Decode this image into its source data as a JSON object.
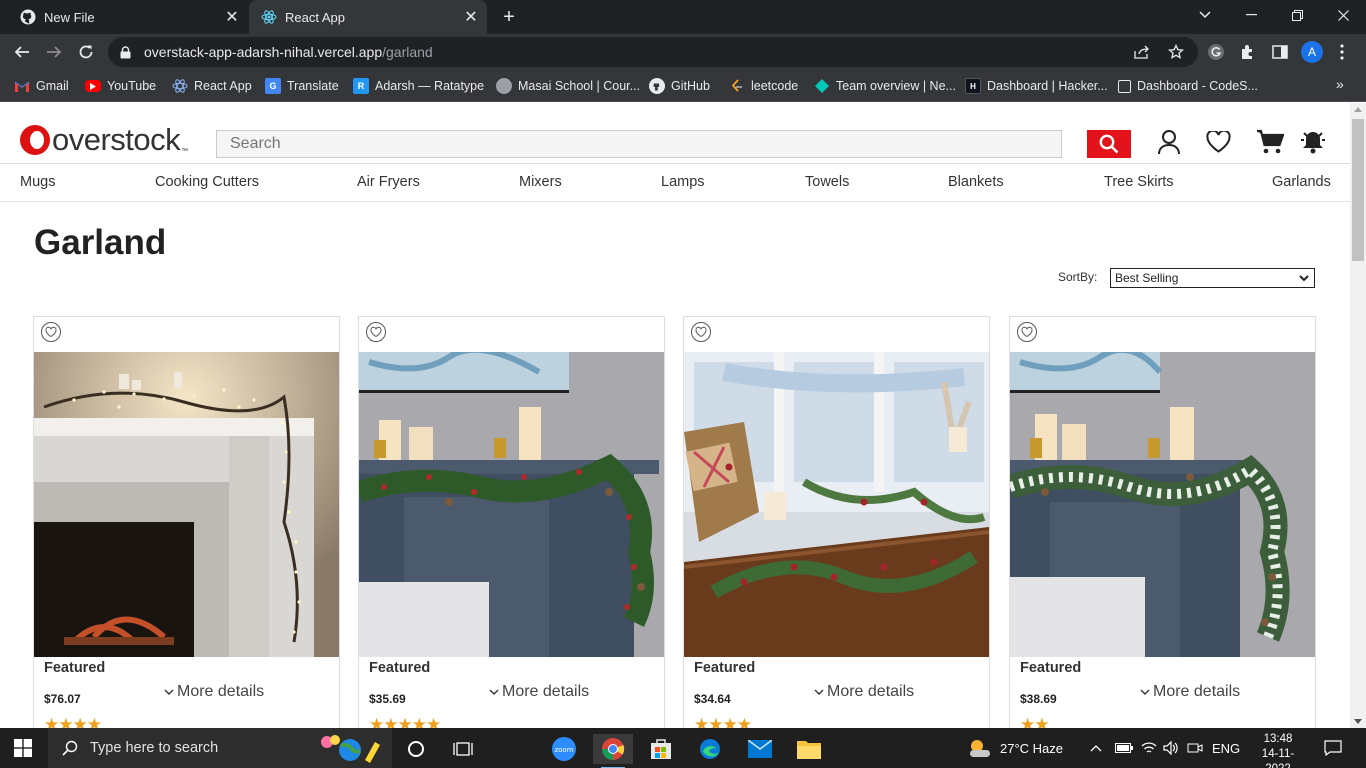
{
  "browser": {
    "tabs": [
      {
        "title": "New File",
        "active": false
      },
      {
        "title": "React App",
        "active": true
      }
    ],
    "url_host": "overstack-app-adarsh-nihal.vercel.app",
    "url_path": "/garland",
    "profile_initial": "A",
    "bookmarks": [
      {
        "label": "Gmail",
        "icon": "gmail-icon"
      },
      {
        "label": "YouTube",
        "icon": "youtube-icon"
      },
      {
        "label": "React App",
        "icon": "react-icon"
      },
      {
        "label": "Translate",
        "icon": "translate-icon"
      },
      {
        "label": "Adarsh — Ratatype",
        "icon": "ratatype-icon"
      },
      {
        "label": "Masai School | Cour...",
        "icon": "masai-icon"
      },
      {
        "label": "GitHub",
        "icon": "github-icon"
      },
      {
        "label": "leetcode",
        "icon": "leetcode-icon"
      },
      {
        "label": "Team overview | Ne...",
        "icon": "diamond-icon"
      },
      {
        "label": "Dashboard | Hacker...",
        "icon": "hackerrank-icon"
      },
      {
        "label": "Dashboard - CodeS...",
        "icon": "page-icon"
      }
    ]
  },
  "site": {
    "logo_text": "overstock",
    "logo_tm": "™",
    "search_placeholder": "Search",
    "categories": [
      "Mugs",
      "Cooking Cutters",
      "Air Fryers",
      "Mixers",
      "Lamps",
      "Towels",
      "Blankets",
      "Tree Skirts",
      "Garlands"
    ],
    "page_title": "Garland",
    "sort_label": "SortBy:",
    "sort_value": "Best Selling",
    "products": [
      {
        "badge": "Featured",
        "price": "$76.07",
        "more": "More details",
        "rating": 4,
        "image": "lighted-branch-garland-on-white-fireplace"
      },
      {
        "badge": "Featured",
        "price": "$35.69",
        "more": "More details",
        "rating": 5,
        "image": "berry-pine-garland-on-blue-mantel"
      },
      {
        "badge": "Featured",
        "price": "$34.64",
        "more": "More details",
        "rating": 4,
        "image": "berry-garland-on-wood-table"
      },
      {
        "badge": "Featured",
        "price": "$38.69",
        "more": "More details",
        "rating": 2,
        "image": "frosted-pine-garland-on-blue-mantel"
      }
    ]
  },
  "taskbar": {
    "search_placeholder": "Type here to search",
    "weather": "27°C  Haze",
    "language": "ENG",
    "time": "13:48",
    "date": "14-11-2022"
  }
}
